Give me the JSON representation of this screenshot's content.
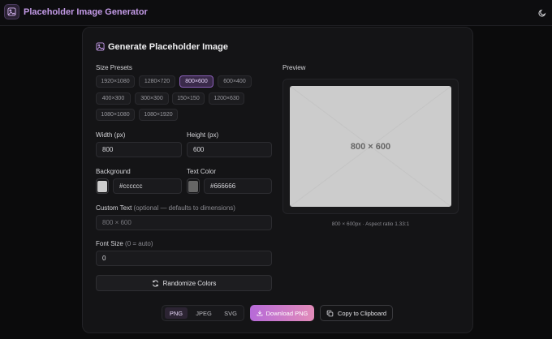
{
  "app": {
    "title": "Placeholder Image Generator",
    "logo_icon": "image-icon",
    "theme_icon": "moon-icon"
  },
  "card": {
    "title": "Generate Placeholder Image",
    "title_icon": "image-icon"
  },
  "presets": {
    "label": "Size Presets",
    "items": [
      "1920×1080",
      "1280×720",
      "800×600",
      "600×400",
      "400×300",
      "300×300",
      "150×150",
      "1200×630",
      "1080×1080",
      "1080×1920"
    ],
    "active": "800×600"
  },
  "width": {
    "label": "Width (px)",
    "value": "800"
  },
  "height": {
    "label": "Height (px)",
    "value": "600"
  },
  "background": {
    "label": "Background",
    "value": "#cccccc",
    "swatch": "#cccccc"
  },
  "text_color": {
    "label": "Text Color",
    "value": "#666666",
    "swatch": "#666666"
  },
  "custom_text": {
    "label": "Custom Text",
    "hint": "(optional — defaults to dimensions)",
    "placeholder": "800 × 600"
  },
  "font_size": {
    "label": "Font Size",
    "hint": "(0 = auto)",
    "value": "0"
  },
  "randomize": {
    "label": "Randomize Colors",
    "icon": "refresh-icon"
  },
  "preview": {
    "label": "Preview",
    "image_text": "800 × 600",
    "meta": "800 × 600px · Aspect ratio 1.33:1",
    "bg_color": "#cccccc",
    "text_color": "#666666"
  },
  "formats": {
    "items": [
      "PNG",
      "JPEG",
      "SVG"
    ],
    "active": "PNG"
  },
  "download": {
    "label": "Download PNG",
    "icon": "download-icon"
  },
  "copy": {
    "label": "Copy to Clipboard",
    "icon": "copy-icon"
  },
  "colors": {
    "accent": "#b66ad8",
    "accent_end": "#e28bb9",
    "title": "#c49be8"
  }
}
